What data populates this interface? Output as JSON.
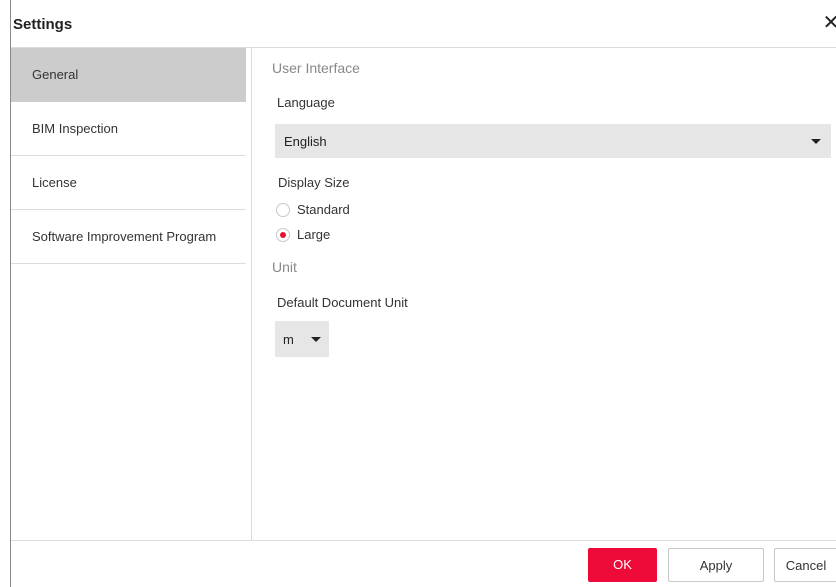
{
  "dialog": {
    "title": "Settings",
    "close_icon": "close-icon"
  },
  "sidebar": {
    "items": [
      {
        "label": "General",
        "active": true
      },
      {
        "label": "BIM Inspection",
        "active": false
      },
      {
        "label": "License",
        "active": false
      },
      {
        "label": "Software Improvement Program",
        "active": false
      }
    ]
  },
  "general": {
    "user_interface_title": "User Interface",
    "language_label": "Language",
    "language_value": "English",
    "display_size_label": "Display Size",
    "display_size_options": [
      {
        "label": "Standard",
        "checked": false
      },
      {
        "label": "Large",
        "checked": true
      }
    ],
    "unit_title": "Unit",
    "default_unit_label": "Default Document Unit",
    "default_unit_value": "m"
  },
  "footer": {
    "ok_label": "OK",
    "apply_label": "Apply",
    "cancel_label": "Cancel"
  },
  "colors": {
    "accent": "#ee0b3a",
    "radio_checked": "#e8112d",
    "active_nav_bg": "#cccccc",
    "select_bg": "#e6e6e6"
  }
}
